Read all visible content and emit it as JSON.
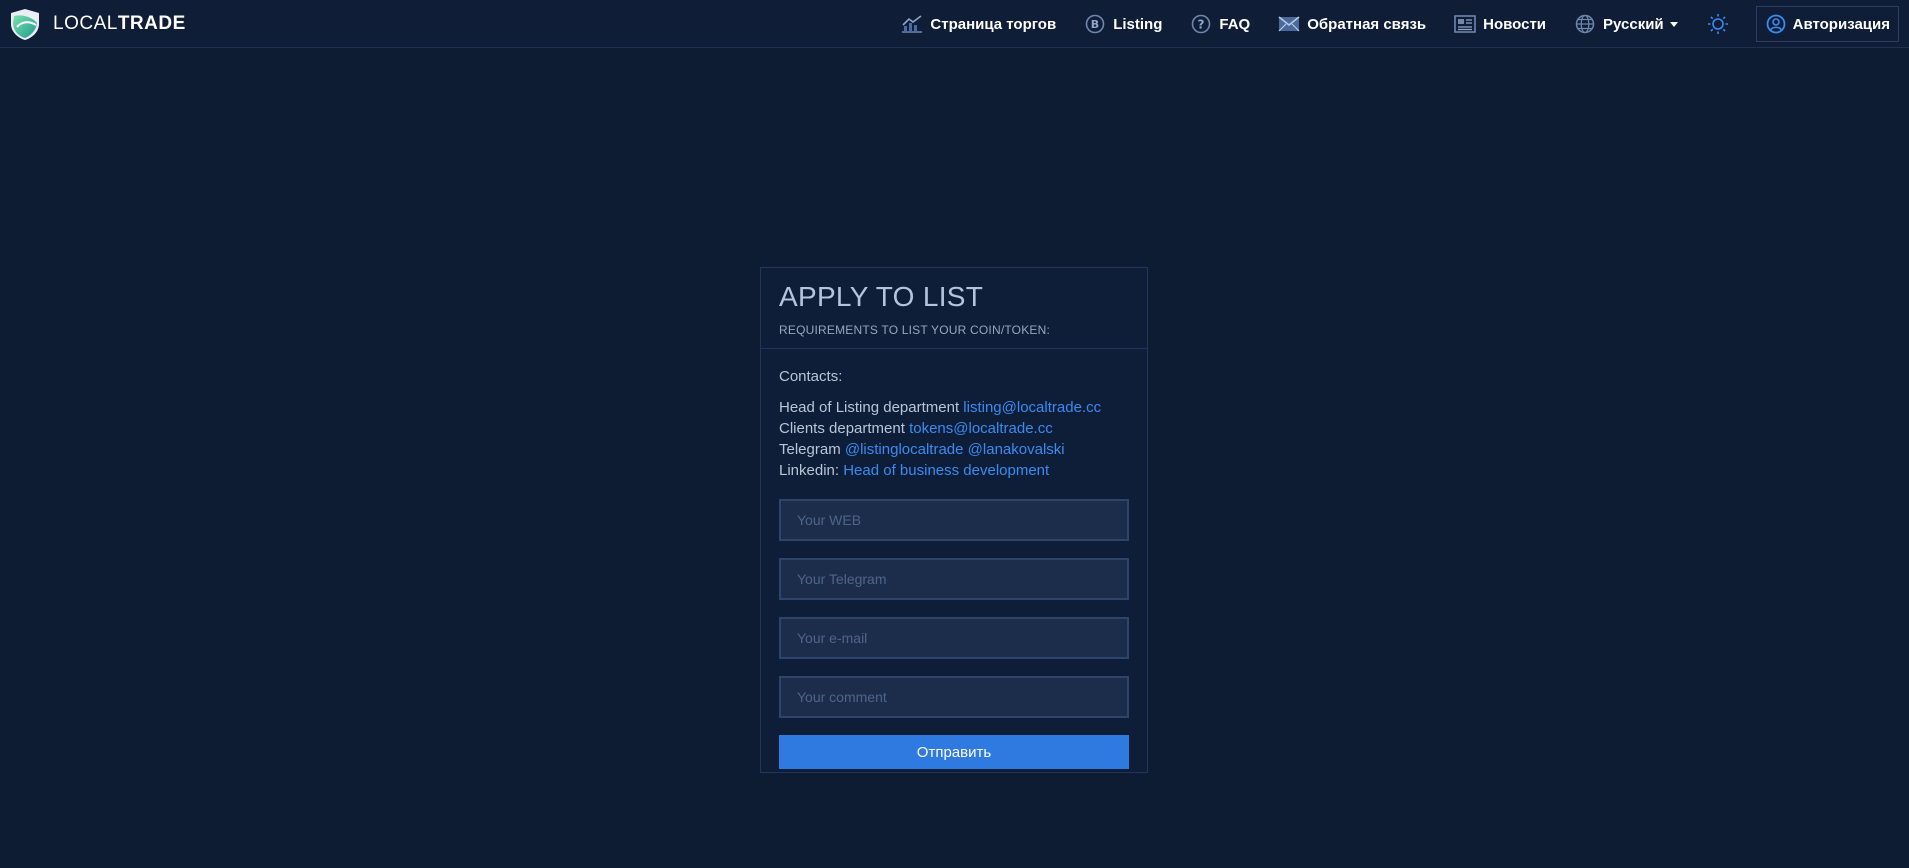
{
  "brand": {
    "name_light": "LOCAL",
    "name_bold": "TRADE"
  },
  "nav": {
    "items": [
      {
        "label": "Страница торгов",
        "icon": "chart-icon"
      },
      {
        "label": "Listing",
        "icon": "bitcoin-icon"
      },
      {
        "label": "FAQ",
        "icon": "question-icon"
      },
      {
        "label": "Обратная связь",
        "icon": "envelope-icon"
      },
      {
        "label": "Новости",
        "icon": "newspaper-icon"
      }
    ],
    "language": "Русский",
    "login_label": "Авторизация"
  },
  "card": {
    "title": "APPLY TO LIST",
    "subtitle": "REQUIREMENTS TO LIST YOUR COIN/TOKEN:",
    "contacts_heading": "Contacts:",
    "contacts": [
      {
        "label": "Head of Listing department",
        "links": [
          "listing@localtrade.cc"
        ]
      },
      {
        "label": "Clients department",
        "links": [
          "tokens@localtrade.cc"
        ]
      },
      {
        "label": "Telegram",
        "links": [
          "@listinglocaltrade",
          "@lanakovalski"
        ]
      },
      {
        "label": "Linkedin:",
        "links": [
          "Head of business development"
        ]
      }
    ],
    "form": {
      "web_placeholder": "Your WEB",
      "telegram_placeholder": "Your Telegram",
      "email_placeholder": "Your e-mail",
      "comment_placeholder": "Your comment",
      "submit_label": "Отправить"
    }
  },
  "colors": {
    "background": "#0d1b33",
    "navbar": "#0f1d36",
    "card": "#0f1e38",
    "link": "#3a8bf0",
    "button": "#2e7ae0",
    "input": "#1c2d4c"
  }
}
